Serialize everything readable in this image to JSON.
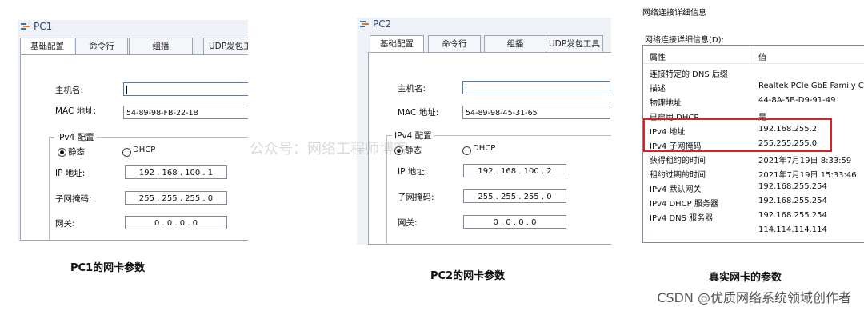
{
  "pc1": {
    "title": "PC1",
    "tabs": [
      "基础配置",
      "命令行",
      "组播",
      "UDP发包工具"
    ],
    "hostname_label": "主机名:",
    "hostname_value": "",
    "mac_label": "MAC 地址:",
    "mac_value": "54-89-98-FB-22-1B",
    "ipv4_group": "IPv4 配置",
    "static_label": "静态",
    "dhcp_label": "DHCP",
    "ip_label": "IP 地址:",
    "ip_value": "192 . 168 . 100 . 1",
    "mask_label": "子网掩码:",
    "mask_value": "255 . 255 . 255 . 0",
    "gw_label": "网关:",
    "gw_value": "0 . 0 . 0 . 0",
    "caption": "PC1的网卡参数"
  },
  "pc2": {
    "title": "PC2",
    "tabs": [
      "基础配置",
      "命令行",
      "组播",
      "UDP发包工具"
    ],
    "hostname_label": "主机名:",
    "hostname_value": "",
    "mac_label": "MAC 地址:",
    "mac_value": "54-89-98-45-31-65",
    "ipv4_group": "IPv4 配置",
    "static_label": "静态",
    "dhcp_label": "DHCP",
    "ip_label": "IP 地址:",
    "ip_value": "192 . 168 . 100 . 2",
    "mask_label": "子网掩码:",
    "mask_value": "255 . 255 . 255 . 0",
    "gw_label": "网关:",
    "gw_value": "0 . 0 . 0 . 0",
    "caption": "PC2的网卡参数"
  },
  "details": {
    "dialog_title": "网络连接详细信息",
    "list_label": "网络连接详细信息(D):",
    "col_property": "属性",
    "col_value": "值",
    "rows": [
      {
        "k": "连接特定的 DNS 后缀",
        "v": ""
      },
      {
        "k": "描述",
        "v": "Realtek PCIe GbE Family C"
      },
      {
        "k": "物理地址",
        "v": "44-8A-5B-D9-91-49"
      },
      {
        "k": "已启用 DHCP",
        "v": "是"
      },
      {
        "k": "IPv4 地址",
        "v": "192.168.255.2"
      },
      {
        "k": "IPv4 子网掩码",
        "v": "255.255.255.0"
      },
      {
        "k": "获得租约的时间",
        "v": "2021年7月19日 8:33:59"
      },
      {
        "k": "租约过期的时间",
        "v": "2021年7月19日 15:33:46"
      },
      {
        "k": "IPv4 默认网关",
        "v": "192.168.255.254"
      },
      {
        "k": "IPv4 DHCP 服务器",
        "v": "192.168.255.254"
      },
      {
        "k": "IPv4 DNS 服务器",
        "v": "192.168.255.254"
      },
      {
        "k": "",
        "v": "114.114.114.114"
      }
    ],
    "caption": "真实网卡的参数"
  },
  "watermark": "公众号：网络工程师博客",
  "footer": "CSDN @优质网络系统领域创作者",
  "colors": {
    "highlight": "#e02020",
    "title_text": "#2a4a7a"
  }
}
